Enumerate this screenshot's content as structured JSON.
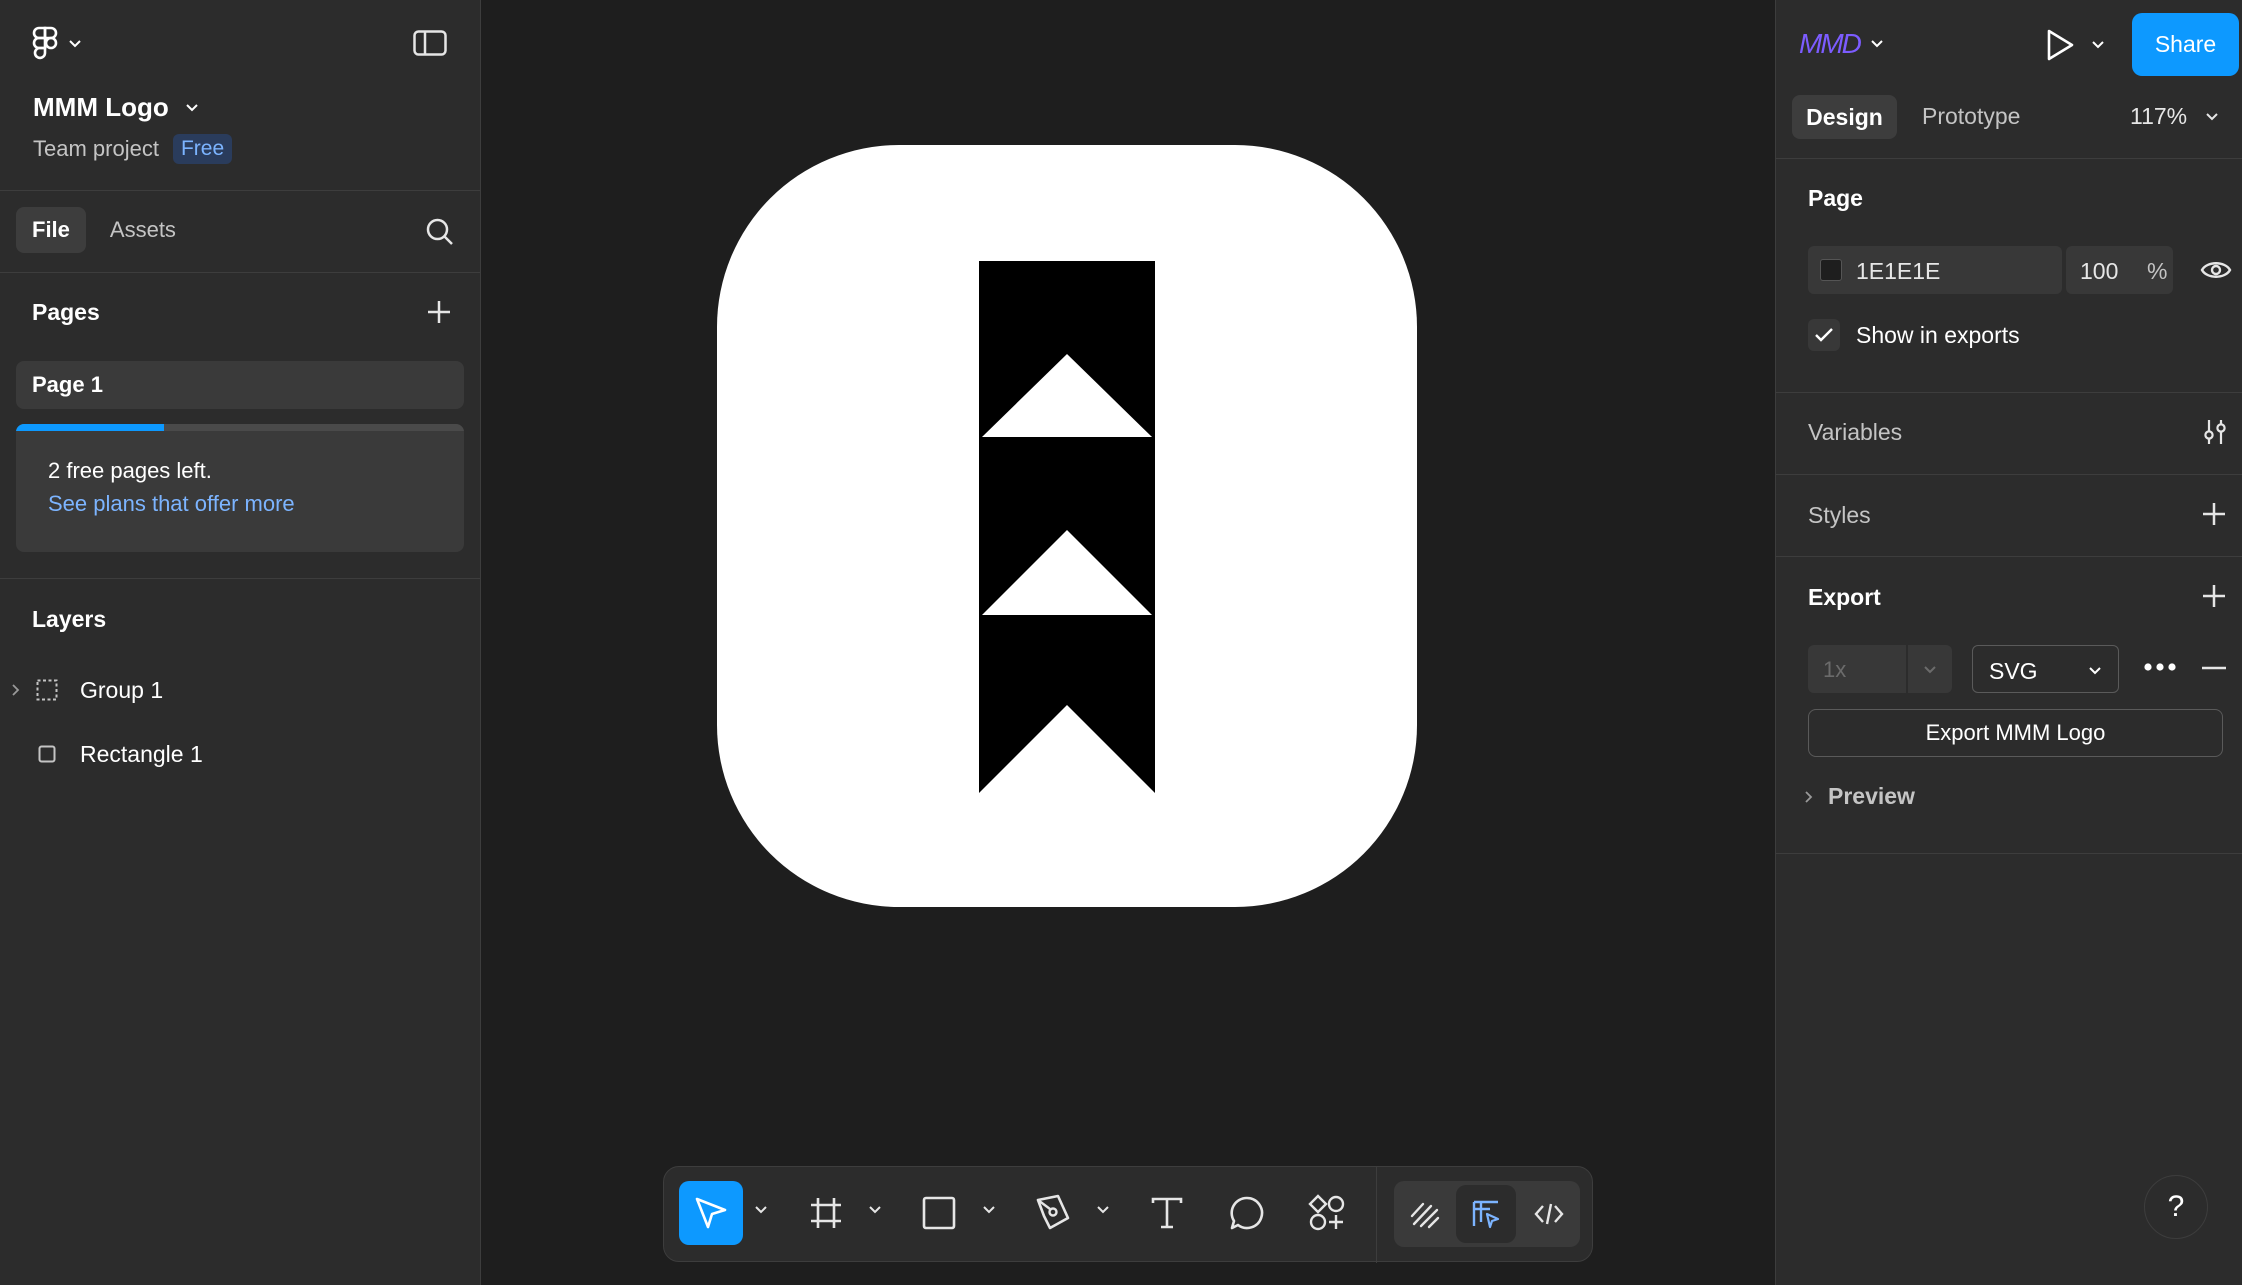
{
  "file": {
    "name": "MMM Logo",
    "project": "Team project",
    "plan_badge": "Free"
  },
  "left_tabs": {
    "file": "File",
    "assets": "Assets"
  },
  "pages": {
    "title": "Pages",
    "items": [
      {
        "label": "Page 1"
      }
    ],
    "notice_text": "2 free pages left.",
    "notice_link": "See plans that offer more",
    "usage_fraction": 0.33
  },
  "layers": {
    "title": "Layers",
    "items": [
      {
        "label": "Group 1",
        "icon": "group-icon"
      },
      {
        "label": "Rectangle 1",
        "icon": "rectangle-icon"
      }
    ]
  },
  "header": {
    "avatar_text": "MMD",
    "share_label": "Share"
  },
  "right_tabs": {
    "design": "Design",
    "prototype": "Prototype",
    "zoom": "117%"
  },
  "page_props": {
    "title": "Page",
    "bg_color": "1E1E1E",
    "opacity": "100",
    "opacity_unit": "%",
    "show_in_exports": "Show in exports"
  },
  "sections": {
    "variables": "Variables",
    "styles": "Styles",
    "export": "Export"
  },
  "export": {
    "scale": "1x",
    "format": "SVG",
    "button_label": "Export MMM Logo",
    "preview_label": "Preview"
  },
  "help_label": "?",
  "colors": {
    "accent": "#0d99ff",
    "panel": "#2c2c2c",
    "canvas": "#1e1e1e",
    "link": "#7cb4ff"
  },
  "toolbar_icons": [
    "move-icon",
    "frame-icon",
    "rectangle-tool-icon",
    "pen-icon",
    "text-icon",
    "comment-icon",
    "actions-icon",
    "draw-mode-icon",
    "design-mode-icon",
    "dev-mode-icon"
  ]
}
